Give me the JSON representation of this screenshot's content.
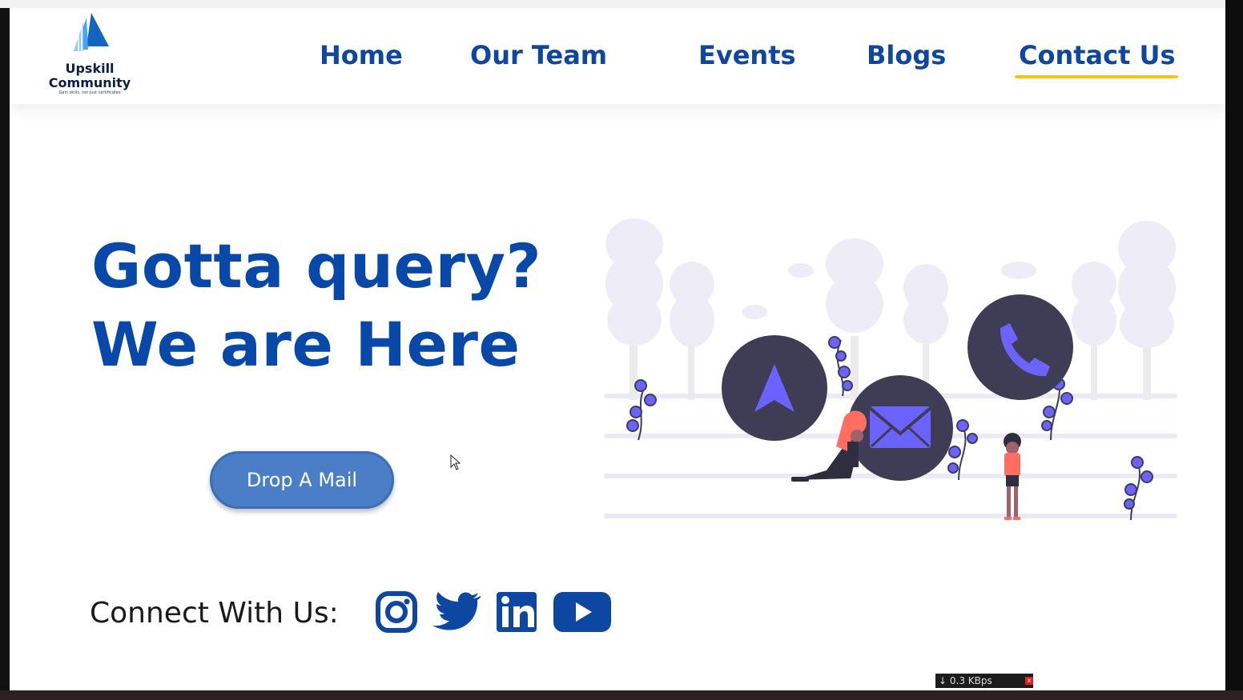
{
  "brand": {
    "line1": "Upskill",
    "line2": "Community",
    "tagline": "Gain skills, not just certificates"
  },
  "nav": {
    "items": [
      {
        "label": "Home"
      },
      {
        "label": "Our Team"
      },
      {
        "label": "Events"
      },
      {
        "label": "Blogs"
      },
      {
        "label": "Contact Us",
        "active": true
      }
    ]
  },
  "hero": {
    "headline_line1": "Gotta query?",
    "headline_line2": "We are Here",
    "cta_label": "Drop A Mail"
  },
  "connect": {
    "label": "Connect With Us:",
    "icons": [
      "instagram-icon",
      "twitter-icon",
      "linkedin-icon",
      "youtube-icon"
    ]
  },
  "illustration": {
    "icons": [
      "navigation-arrow-icon",
      "mail-icon",
      "phone-icon"
    ]
  },
  "status": {
    "network_speed": "↓ 0.3 KBps",
    "close": "x"
  },
  "colors": {
    "nav_text": "#0d47a1",
    "headline": "#0748a8",
    "active_underline": "#f5c518",
    "cta_bg": "#4a7fc8",
    "accent_purple": "#6c63ff",
    "circle_dark": "#3f3d56"
  }
}
